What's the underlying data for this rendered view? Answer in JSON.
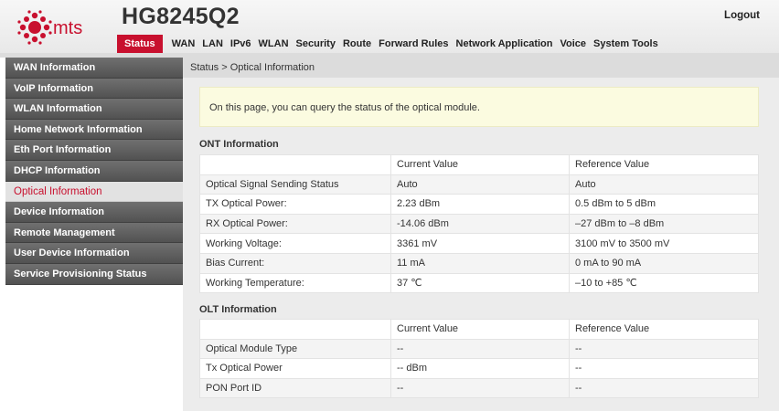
{
  "header": {
    "brand": "mts",
    "device_title": "HG8245Q2",
    "logout": "Logout",
    "brand_color": "#c8102e",
    "menu": [
      "Status",
      "WAN",
      "LAN",
      "IPv6",
      "WLAN",
      "Security",
      "Route",
      "Forward Rules",
      "Network Application",
      "Voice",
      "System Tools"
    ],
    "active_menu": "Status"
  },
  "sidebar": {
    "items": [
      {
        "label": "WAN Information"
      },
      {
        "label": "VoIP Information"
      },
      {
        "label": "WLAN Information"
      },
      {
        "label": "Home Network Information"
      },
      {
        "label": "Eth Port Information"
      },
      {
        "label": "DHCP Information"
      },
      {
        "label": "Optical Information"
      },
      {
        "label": "Device Information"
      },
      {
        "label": "Remote Management"
      },
      {
        "label": "User Device Information"
      },
      {
        "label": "Service Provisioning Status"
      }
    ],
    "active": "Optical Information"
  },
  "breadcrumb": "Status > Optical Information",
  "note": "On this page, you can query the status of the optical module.",
  "ont": {
    "title": "ONT Information",
    "headers": [
      "",
      "Current Value",
      "Reference Value"
    ],
    "rows": [
      [
        "Optical Signal Sending Status",
        "Auto",
        "Auto"
      ],
      [
        "TX Optical Power:",
        "2.23 dBm",
        "0.5 dBm to 5 dBm"
      ],
      [
        "RX Optical Power:",
        "-14.06 dBm",
        "–27 dBm to –8 dBm"
      ],
      [
        "Working Voltage:",
        "3361 mV",
        "3100 mV to 3500 mV"
      ],
      [
        "Bias Current:",
        "11 mA",
        "0 mA to 90 mA"
      ],
      [
        "Working Temperature:",
        "37 ℃",
        "–10 to +85 ℃"
      ]
    ]
  },
  "olt": {
    "title": "OLT Information",
    "headers": [
      "",
      "Current Value",
      "Reference Value"
    ],
    "rows": [
      [
        "Optical Module Type",
        "--",
        "--"
      ],
      [
        "Tx Optical Power",
        "-- dBm",
        "--"
      ],
      [
        "PON Port ID",
        "--",
        "--"
      ]
    ]
  }
}
